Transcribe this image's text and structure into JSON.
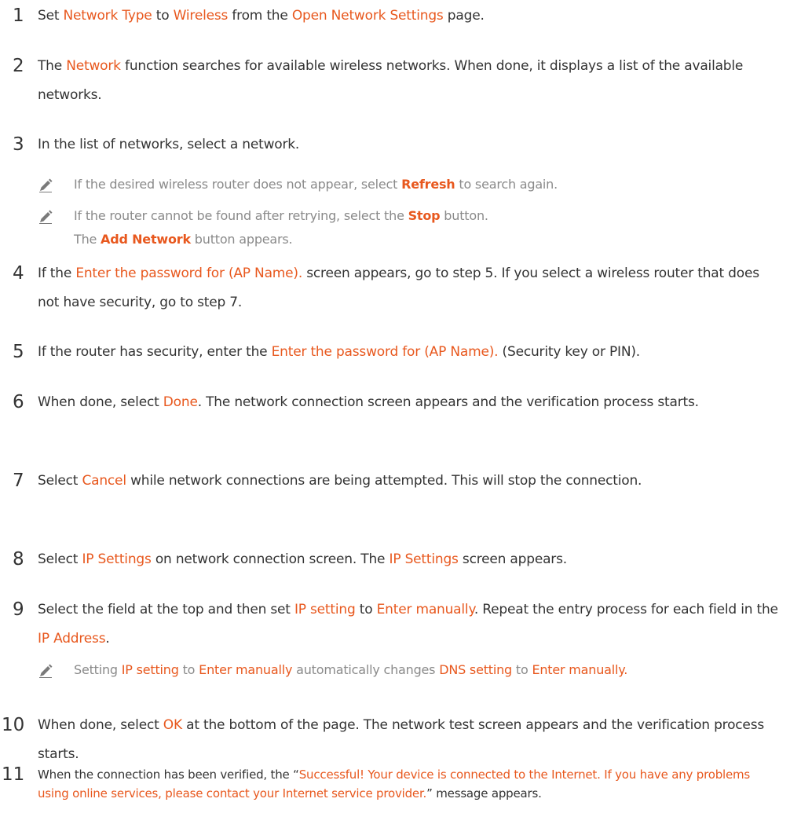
{
  "steps": [
    {
      "num": "1",
      "p": [
        "Set ",
        "Network Type",
        " to ",
        "Wireless",
        " from the ",
        "Open Network Settings",
        " page."
      ]
    },
    {
      "num": "2",
      "p": [
        "The ",
        "Network",
        " function searches for available wireless networks. When done, it displays a list of the available networks."
      ]
    },
    {
      "num": "3",
      "p": [
        "In the list of networks, select a network."
      ]
    },
    {
      "num": "4",
      "p": [
        "If the ",
        "Enter the password for (AP Name).",
        " screen appears, go to step 5. If you select a wireless router that does not have security, go to step 7."
      ]
    },
    {
      "num": "5",
      "p": [
        "If the router has security, enter the ",
        "Enter the password for (AP Name).",
        " (Security key or PIN)."
      ]
    },
    {
      "num": "6",
      "p": [
        "When done, select ",
        "Done",
        ". The network connection screen appears and the verification process starts."
      ]
    },
    {
      "num": "7",
      "p": [
        "Select ",
        "Cancel",
        " while network connections are being attempted. This will stop the connection."
      ]
    },
    {
      "num": "8",
      "p": [
        "Select ",
        "IP Settings",
        " on network connection screen. The ",
        "IP Settings",
        " screen appears."
      ]
    },
    {
      "num": "9",
      "p": [
        "Select the field at the top and then set ",
        "IP setting",
        " to ",
        "Enter manually",
        ". Repeat the entry process for each field in the ",
        "IP Address",
        "."
      ]
    },
    {
      "num": "10",
      "p": [
        "When done, select ",
        "OK",
        " at the bottom of the page. The network test screen appears and the verification process starts."
      ]
    },
    {
      "num": "11",
      "p": [
        "When the connection has been verified, the “",
        "Successful! Your device is connected to the Internet. If you have any problems using online services, please contact your Internet service provider.",
        "” message appears."
      ]
    }
  ],
  "notes": {
    "n3a": [
      "If the desired wireless router does not appear, select ",
      "Refresh",
      " to search again."
    ],
    "n3b": [
      "If the router cannot be found after retrying, select the ",
      "Stop",
      " button."
    ],
    "n3c": [
      "The ",
      "Add Network",
      " button appears."
    ],
    "n9": [
      "Setting ",
      "IP setting",
      " to ",
      "Enter manually",
      " automatically changes ",
      "DNS setting",
      " to ",
      "Enter manually",
      "."
    ]
  },
  "colors": {
    "text": "#333333",
    "highlight": "#e8581e",
    "note_text": "#8a8a8a"
  },
  "icons": {
    "note": "pencil-note-icon"
  }
}
